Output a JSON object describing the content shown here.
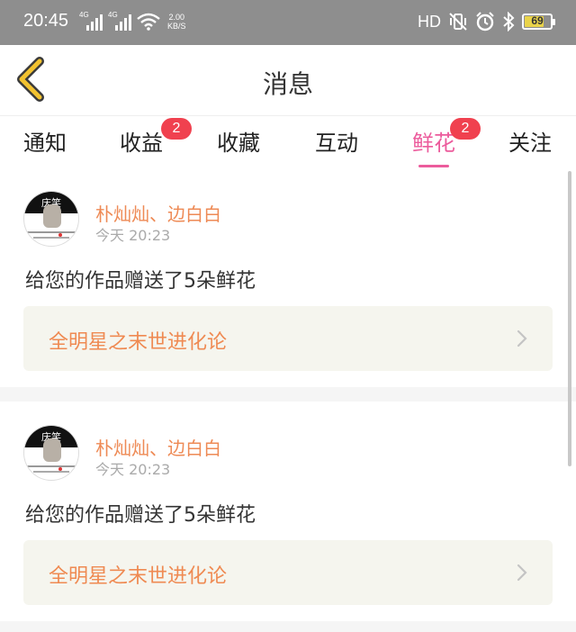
{
  "status_bar": {
    "time": "20:45",
    "network1": "4G",
    "network2": "4G",
    "speed_value": "2.00",
    "speed_unit": "KB/S",
    "hd": "HD",
    "battery": "69"
  },
  "header": {
    "title": "消息"
  },
  "tabs": [
    {
      "label": "通知"
    },
    {
      "label": "收益",
      "badge": "2"
    },
    {
      "label": "收藏"
    },
    {
      "label": "互动"
    },
    {
      "label": "鲜花",
      "badge": "2"
    },
    {
      "label": "关注"
    }
  ],
  "messages": [
    {
      "avatar_text": "庆笑",
      "sender": "朴灿灿、边白白",
      "time": "今天 20:23",
      "text": "给您的作品赠送了5朵鲜花",
      "work_title": "全明星之末世进化论"
    },
    {
      "avatar_text": "庆笑",
      "sender": "朴灿灿、边白白",
      "time": "今天 20:23",
      "text": "给您的作品赠送了5朵鲜花",
      "work_title": "全明星之末世进化论"
    }
  ],
  "colors": {
    "accent_pink": "#ec5b9c",
    "accent_orange": "#ee8a55",
    "badge_red": "#f0414f",
    "back_arrow_yellow": "#f2c230"
  }
}
